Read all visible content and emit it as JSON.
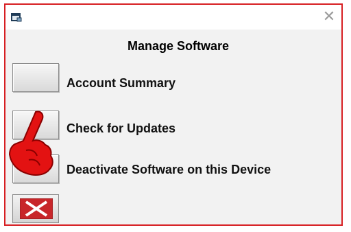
{
  "window": {
    "close_glyph": "✕",
    "accent_color": "#d71e22"
  },
  "dialog": {
    "heading": "Manage Software",
    "options": [
      {
        "label": "Account Summary"
      },
      {
        "label": "Check for Updates"
      },
      {
        "label": "Deactivate Software on this Device"
      }
    ]
  },
  "icons": {
    "app": "app-window-icon",
    "close": "close-icon",
    "exit": "red-x-icon",
    "pointer": "pointing-hand-cursor-icon"
  }
}
